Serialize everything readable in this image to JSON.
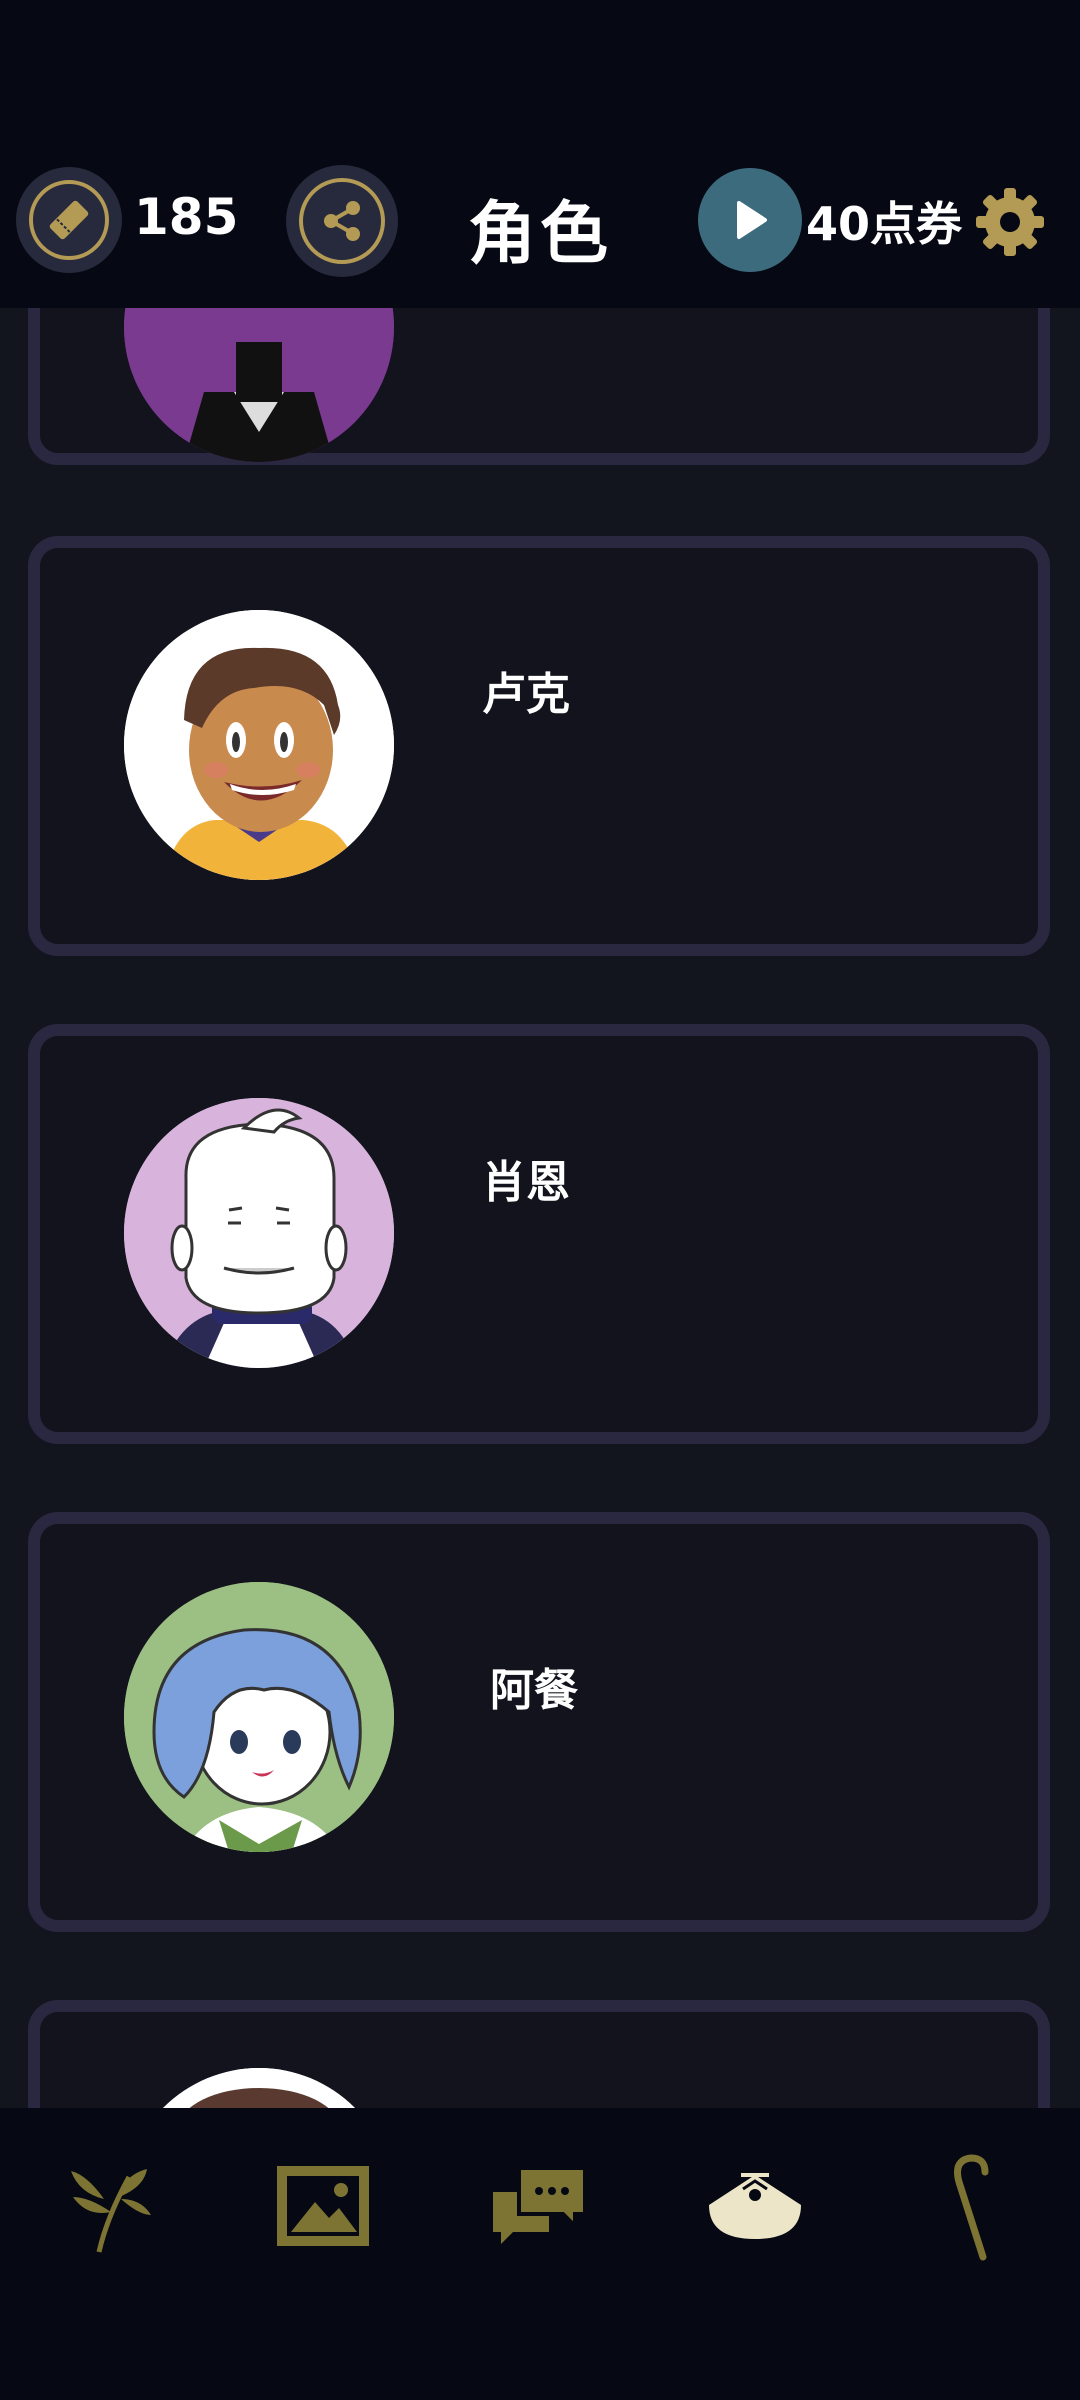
{
  "header": {
    "title": "角色",
    "tickets_count": "185",
    "points_label": "40点券"
  },
  "characters": [
    {
      "name": ""
    },
    {
      "name": "卢克"
    },
    {
      "name": "肖恩"
    },
    {
      "name": "阿餐"
    },
    {
      "name": ""
    }
  ],
  "colors": {
    "background": "#12141e",
    "bar": "#060913",
    "card_border": "#2a2840",
    "gold": "#b39a55",
    "nav_gold": "#7d7433",
    "ad_button": "#3d6b7e"
  },
  "icons": {
    "tickets": "ticket-icon",
    "share": "share-icon",
    "ad": "play-icon",
    "settings": "gear-icon",
    "nav": [
      "sprout-icon",
      "gallery-icon",
      "chat-icon",
      "fan-icon",
      "cane-icon"
    ]
  }
}
